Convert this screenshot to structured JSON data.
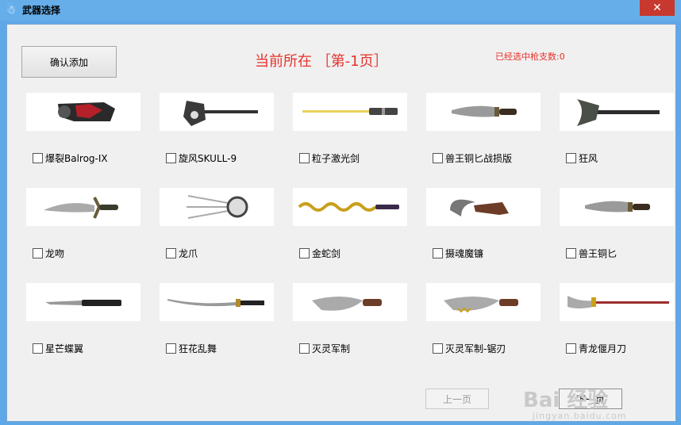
{
  "window": {
    "title": "武器选择",
    "close_icon": "close-icon",
    "app_icon": "cs-app-icon"
  },
  "toolbar": {
    "confirm_label": "确认添加",
    "page_indicator": "当前所在 ［第-1页］",
    "selected_count": "已经选中枪支数:0"
  },
  "weapons": [
    {
      "label": "爆裂Balrog-IX",
      "checked": false,
      "icon": "balrog-gauntlet-icon"
    },
    {
      "label": "旋风SKULL-9",
      "checked": false,
      "icon": "skull-axe-icon"
    },
    {
      "label": "粒子激光剑",
      "checked": false,
      "icon": "laser-sword-icon"
    },
    {
      "label": "兽王铜匕战损版",
      "checked": false,
      "icon": "knife-icon"
    },
    {
      "label": "狂风",
      "checked": false,
      "icon": "battle-axe-icon"
    },
    {
      "label": "龙吻",
      "checked": false,
      "icon": "dragon-dagger-icon"
    },
    {
      "label": "龙爪",
      "checked": false,
      "icon": "claw-icon"
    },
    {
      "label": "金蛇剑",
      "checked": false,
      "icon": "golden-snake-sword-icon"
    },
    {
      "label": "摄魂魔镰",
      "checked": false,
      "icon": "sickle-icon"
    },
    {
      "label": "兽王铜匕",
      "checked": false,
      "icon": "knife-icon"
    },
    {
      "label": "星芒蝶翼",
      "checked": false,
      "icon": "butterfly-knife-icon"
    },
    {
      "label": "狂花乱舞",
      "checked": false,
      "icon": "katana-icon"
    },
    {
      "label": "灭灵军制",
      "checked": false,
      "icon": "kukri-icon"
    },
    {
      "label": "灭灵军制-锯刃",
      "checked": false,
      "icon": "serrated-kukri-icon"
    },
    {
      "label": "青龙偃月刀",
      "checked": false,
      "icon": "glaive-icon"
    }
  ],
  "pagination": {
    "prev_label": "上一页",
    "next_label": "下一页",
    "prev_enabled": false
  },
  "watermark": {
    "text": "Bai 经验",
    "sub": "jingyan.baidu.com"
  },
  "colors": {
    "accent_red": "#e8312b",
    "titlebar": "#66aeea",
    "close": "#c7382f"
  }
}
